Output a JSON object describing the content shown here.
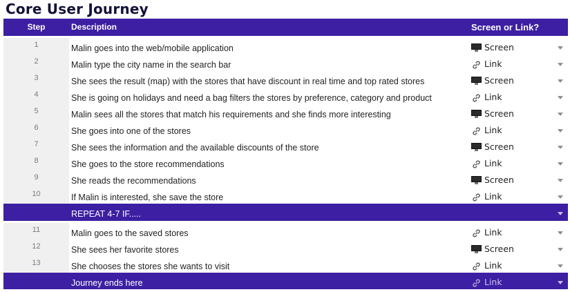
{
  "title": "Core User Journey",
  "colors": {
    "header_bg": "#3c1fa2",
    "step_cell_bg": "#f0f0f0",
    "title_color": "#12123a"
  },
  "table": {
    "headers": {
      "step": "Step",
      "description": "Description",
      "type": "Screen or Link?"
    },
    "rows": [
      {
        "step": "1",
        "description": "Malin goes into the web/mobile application",
        "type": "Screen",
        "icon": "desktop-computer-icon"
      },
      {
        "step": "2",
        "description": "Malin type the city name in the search bar",
        "type": "Link",
        "icon": "link-icon"
      },
      {
        "step": "3",
        "description": "She sees the result (map) with the stores that have discount in real time and top rated stores",
        "type": "Screen",
        "icon": "desktop-computer-icon"
      },
      {
        "step": "4",
        "description": "She is going on holidays and need a bag filters the stores by preference, category and product",
        "type": "Link",
        "icon": "link-icon"
      },
      {
        "step": "5",
        "description": "Malin sees all the stores that match his requirements and she finds more interesting",
        "type": "Screen",
        "icon": "desktop-computer-icon"
      },
      {
        "step": "6",
        "description": "She goes into one of the stores",
        "type": "Link",
        "icon": "link-icon"
      },
      {
        "step": "7",
        "description": "She sees the information and the available discounts of the store",
        "type": "Screen",
        "icon": "desktop-computer-icon"
      },
      {
        "step": "8",
        "description": "She goes to the store recommendations",
        "type": "Link",
        "icon": "link-icon"
      },
      {
        "step": "9",
        "description": "She reads the recommendations",
        "type": "Screen",
        "icon": "desktop-computer-icon"
      },
      {
        "step": "10",
        "description": "If Malin is interested, she save the store",
        "type": "Link",
        "icon": "link-icon"
      }
    ],
    "repeat_banner": {
      "description": "REPEAT 4-7 IF....."
    },
    "rows_after": [
      {
        "step": "11",
        "description": "Malin goes to the saved stores",
        "type": "Link",
        "icon": "link-icon"
      },
      {
        "step": "12",
        "description": "She sees her favorite stores",
        "type": "Screen",
        "icon": "desktop-computer-icon"
      },
      {
        "step": "13",
        "description": "She chooses the stores she wants to visit",
        "type": "Link",
        "icon": "link-icon"
      }
    ],
    "end_banner": {
      "description": "Journey ends here",
      "type": "Link",
      "icon": "link-icon"
    }
  }
}
